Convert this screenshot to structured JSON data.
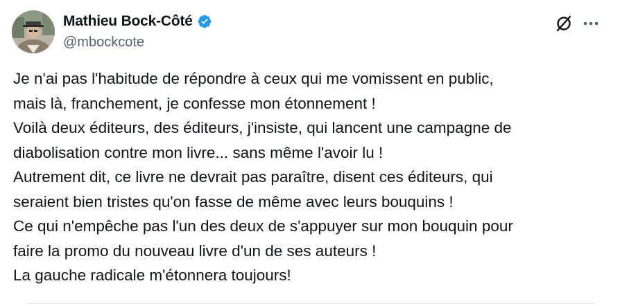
{
  "author": {
    "display_name": "Mathieu Bock-Côté",
    "handle": "@mbockcote",
    "verified": true,
    "verified_color": "#1d9bf0"
  },
  "icons": {
    "avatar": "profile-photo",
    "verified": "verified-badge-icon",
    "grok": "grok-icon",
    "more": "more-options-icon"
  },
  "tweet": {
    "lines": [
      "Je n'ai pas l'habitude de répondre à ceux qui me vomissent en public,",
      "mais là, franchement, je confesse mon étonnement !",
      "Voilà deux éditeurs, des éditeurs, j'insiste, qui lancent une campagne de",
      "diabolisation contre mon livre... sans même l'avoir lu !",
      "Autrement dit, ce livre ne devrait pas paraître, disent ces éditeurs, qui",
      "seraient bien tristes qu'on fasse de même avec leurs bouquins !",
      "Ce qui n'empêche pas l'un des deux de s'appuyer sur mon bouquin pour",
      "faire la promo du nouveau livre d'un de ses auteurs !",
      "La gauche radicale m'étonnera toujours!"
    ]
  },
  "colors": {
    "text": "#0f1419",
    "secondary_text": "#536471",
    "divider": "#e1e8ed"
  }
}
